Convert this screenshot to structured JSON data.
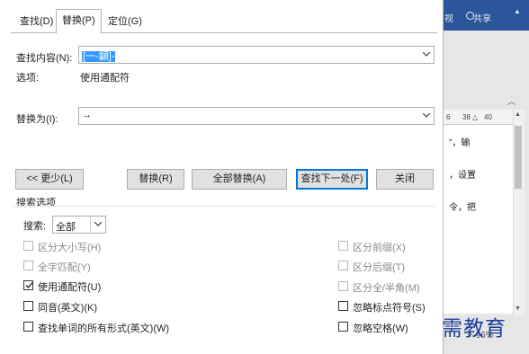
{
  "background_window": {
    "tab_fragment": "视",
    "share_label": "共享",
    "ruler_ticks": [
      "6",
      "38",
      "40"
    ],
    "document_lines": [
      "”，输",
      "，设置",
      "令，把"
    ],
    "zoom_level": "96%",
    "watermark": "最需教育"
  },
  "dialog": {
    "tabs": [
      {
        "label": "查找(D)",
        "active": false
      },
      {
        "label": "替换(P)",
        "active": true
      },
      {
        "label": "定位(G)",
        "active": false
      }
    ],
    "find": {
      "label": "查找内容(N):",
      "value": "[一-龥]-",
      "options_label": "选项:",
      "options_value": "使用通配符"
    },
    "replace": {
      "label": "替换为(I):",
      "value": "→"
    },
    "buttons": {
      "less": "<< 更少(L)",
      "replace": "替换(R)",
      "replace_all": "全部替换(A)",
      "find_next": "查找下一处(F)",
      "close": "关闭"
    },
    "search_options": {
      "title": "搜索选项",
      "search_label": "搜索:",
      "search_value": "全部",
      "left_options": [
        {
          "label": "区分大小写(H)",
          "checked": false,
          "enabled": false
        },
        {
          "label": "全字匹配(Y)",
          "checked": false,
          "enabled": false
        },
        {
          "label": "使用通配符(U)",
          "checked": true,
          "enabled": true
        },
        {
          "label": "同音(英文)(K)",
          "checked": false,
          "enabled": true
        },
        {
          "label": "查找单词的所有形式(英文)(W)",
          "checked": false,
          "enabled": true
        }
      ],
      "right_options": [
        {
          "label": "区分前缀(X)",
          "checked": false,
          "enabled": false
        },
        {
          "label": "区分后缀(T)",
          "checked": false,
          "enabled": false
        },
        {
          "label": "区分全/半角(M)",
          "checked": false,
          "enabled": false
        },
        {
          "label": "忽略标点符号(S)",
          "checked": false,
          "enabled": true
        },
        {
          "label": "忽略空格(W)",
          "checked": false,
          "enabled": true
        }
      ]
    }
  },
  "colors": {
    "selection": "#3399ff",
    "focus_border": "#0078d7",
    "title_bar": "#2b579a",
    "watermark": "#1b3f9a"
  }
}
